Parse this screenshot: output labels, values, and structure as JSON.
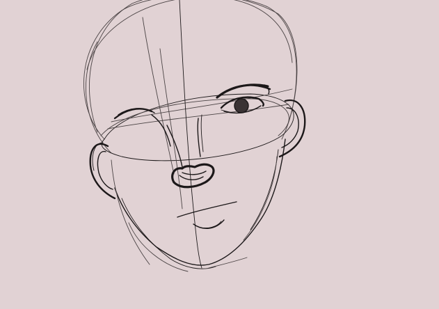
{
  "colors": {
    "background": "#e1d2d4",
    "ink": "#1c1819",
    "ink_soft": "#4a4344",
    "iris": "#3a3334"
  }
}
